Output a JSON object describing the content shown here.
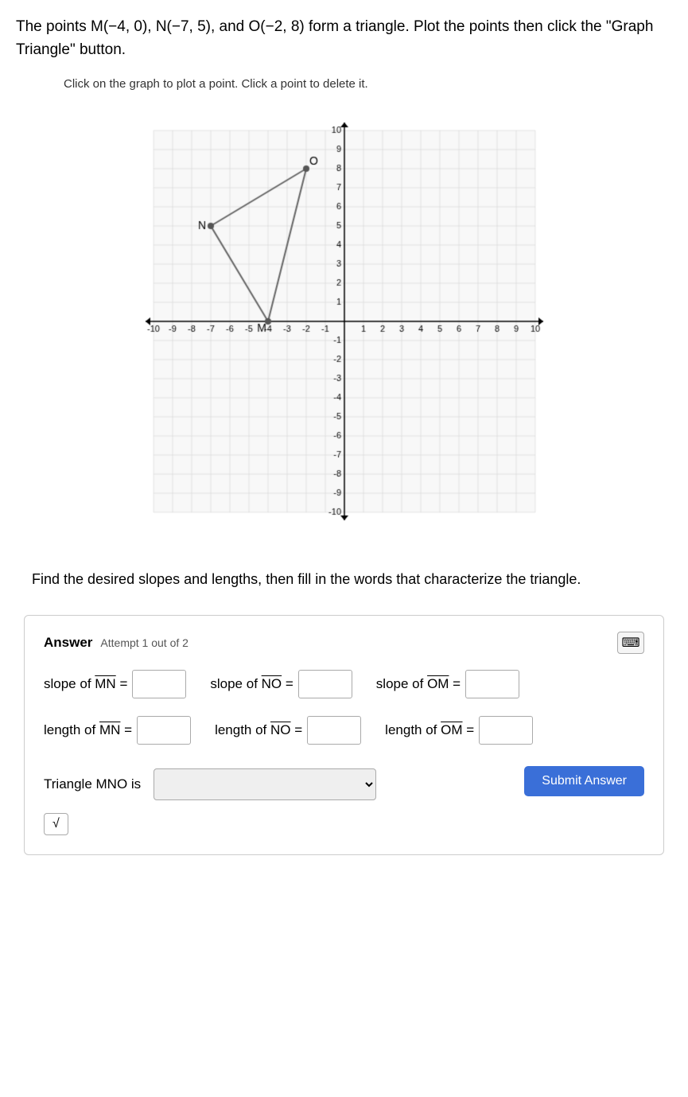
{
  "problem": {
    "text": "The points M(−4, 0), N(−7, 5), and O(−2, 8) form a triangle. Plot the points then click the \"Graph Triangle\" button.",
    "instruction": "Click on the graph to plot a point. Click a point to delete it."
  },
  "secondary_text": "Find the desired slopes and lengths, then fill in the words that characterize the triangle.",
  "answer_section": {
    "label": "Answer",
    "attempt": "Attempt 1 out of 2",
    "slope_MN_label": "slope of MN =",
    "slope_NO_label": "slope of NO =",
    "slope_OM_label": "slope of OM =",
    "length_MN_label": "length of MN =",
    "length_NO_label": "length of NO =",
    "length_OM_label": "length of OM =",
    "triangle_label": "Triangle MNO is",
    "submit_label": "Submit Answer",
    "sqrt_label": "√"
  },
  "points": {
    "M": {
      "x": -4,
      "y": 0,
      "label": "M"
    },
    "N": {
      "x": -7,
      "y": 5,
      "label": "N"
    },
    "O": {
      "x": -2,
      "y": 8,
      "label": "O"
    }
  },
  "icons": {
    "keyboard": "⌨"
  }
}
